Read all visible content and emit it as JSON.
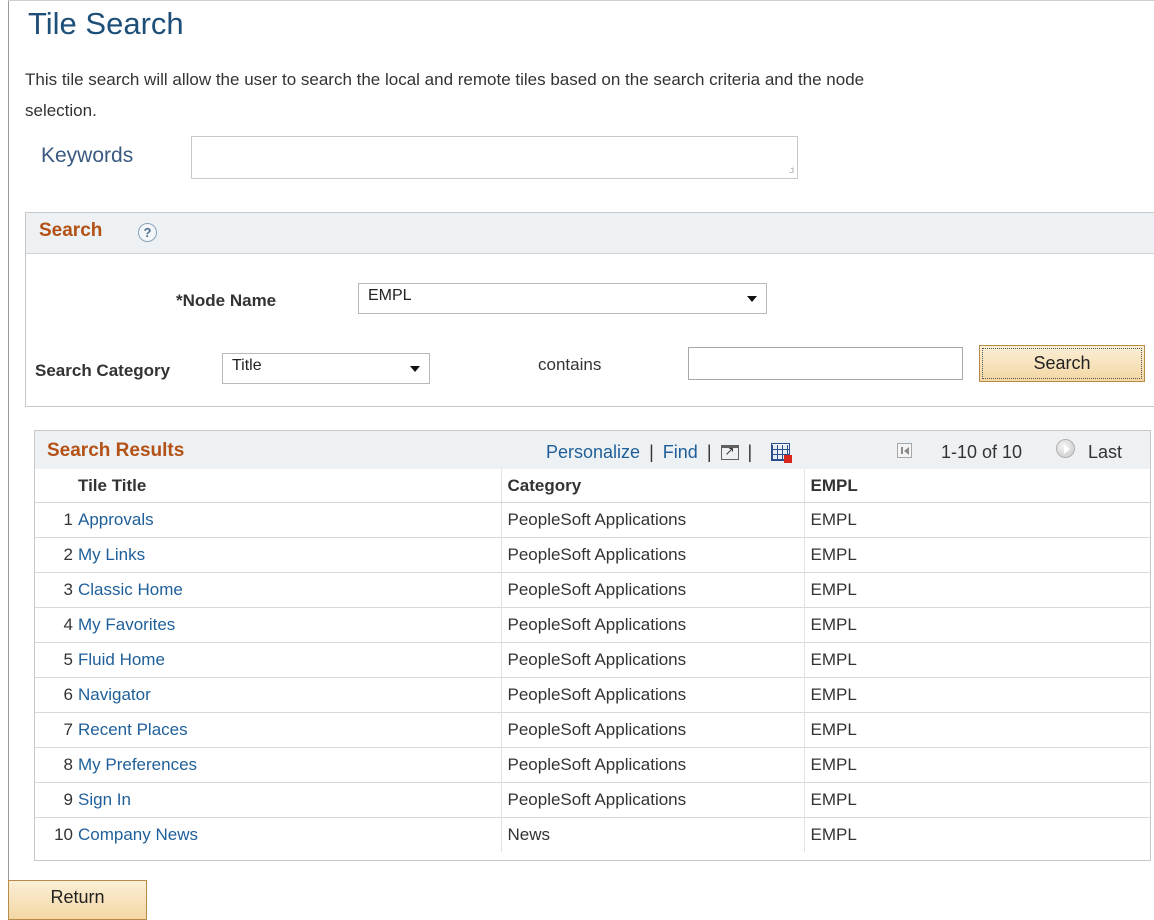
{
  "page": {
    "title": "Tile Search",
    "description": "This tile search will allow the user to search the local and remote tiles based on the search criteria and the node selection."
  },
  "keywords": {
    "label": "Keywords",
    "value": ""
  },
  "search": {
    "section_title": "Search",
    "help_icon": "help-icon",
    "node_name_label": "*Node Name",
    "node_name_value": "EMPL",
    "category_label": "Search Category",
    "category_value": "Title",
    "operator_label": "contains",
    "search_value": "",
    "search_button_label": "Search"
  },
  "results": {
    "title": "Search Results",
    "toolbar": {
      "personalize": "Personalize",
      "find": "Find",
      "separator": "|",
      "new_window_icon": "new-window-icon",
      "download_icon": "download-to-excel-icon"
    },
    "pagination": {
      "range": "1-10 of 10",
      "last": "Last"
    },
    "columns": [
      "Tile Title",
      "Category",
      "EMPL"
    ],
    "rows": [
      {
        "num": "1",
        "title": "Approvals",
        "category": "PeopleSoft Applications",
        "node": "EMPL"
      },
      {
        "num": "2",
        "title": "My Links",
        "category": "PeopleSoft Applications",
        "node": "EMPL"
      },
      {
        "num": "3",
        "title": "Classic Home",
        "category": "PeopleSoft Applications",
        "node": "EMPL"
      },
      {
        "num": "4",
        "title": "My Favorites",
        "category": "PeopleSoft Applications",
        "node": "EMPL"
      },
      {
        "num": "5",
        "title": "Fluid Home",
        "category": "PeopleSoft Applications",
        "node": "EMPL"
      },
      {
        "num": "6",
        "title": "Navigator",
        "category": "PeopleSoft Applications",
        "node": "EMPL"
      },
      {
        "num": "7",
        "title": "Recent Places",
        "category": "PeopleSoft Applications",
        "node": "EMPL"
      },
      {
        "num": "8",
        "title": "My Preferences",
        "category": "PeopleSoft Applications",
        "node": "EMPL"
      },
      {
        "num": "9",
        "title": "Sign In",
        "category": "PeopleSoft Applications",
        "node": "EMPL"
      },
      {
        "num": "10",
        "title": "Company News",
        "category": "News",
        "node": "EMPL"
      }
    ]
  },
  "footer": {
    "return_button_label": "Return"
  },
  "colors": {
    "title_blue": "#1e4f79",
    "section_orange": "#b45116",
    "link_blue": "#1f5f99",
    "button_gold": "#f3d7a4"
  }
}
